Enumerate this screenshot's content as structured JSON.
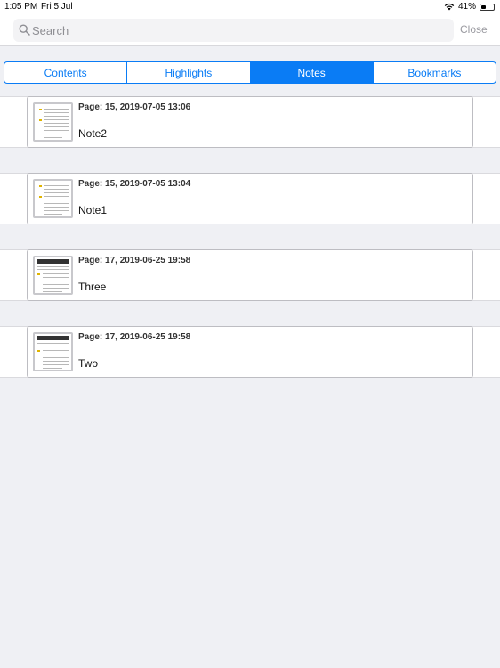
{
  "status_bar": {
    "time": "1:05 PM",
    "date": "Fri 5 Jul",
    "battery": "41%",
    "battery_level": 0.41
  },
  "search": {
    "placeholder": "Search",
    "close_label": "Close"
  },
  "tabs": [
    {
      "label": "Contents",
      "active": false
    },
    {
      "label": "Highlights",
      "active": false
    },
    {
      "label": "Notes",
      "active": true
    },
    {
      "label": "Bookmarks",
      "active": false
    }
  ],
  "notes": [
    {
      "meta": "Page: 15, 2019-07-05 13:06",
      "text": "Note2",
      "thumb_style": "text"
    },
    {
      "meta": "Page: 15, 2019-07-05 13:04",
      "text": "Note1",
      "thumb_style": "text"
    },
    {
      "meta": "Page: 17, 2019-06-25 19:58",
      "text": "Three",
      "thumb_style": "header"
    },
    {
      "meta": "Page: 17, 2019-06-25 19:58",
      "text": "Two",
      "thumb_style": "header"
    }
  ],
  "colors": {
    "accent": "#0a7cf5",
    "background": "#eff0f4"
  }
}
